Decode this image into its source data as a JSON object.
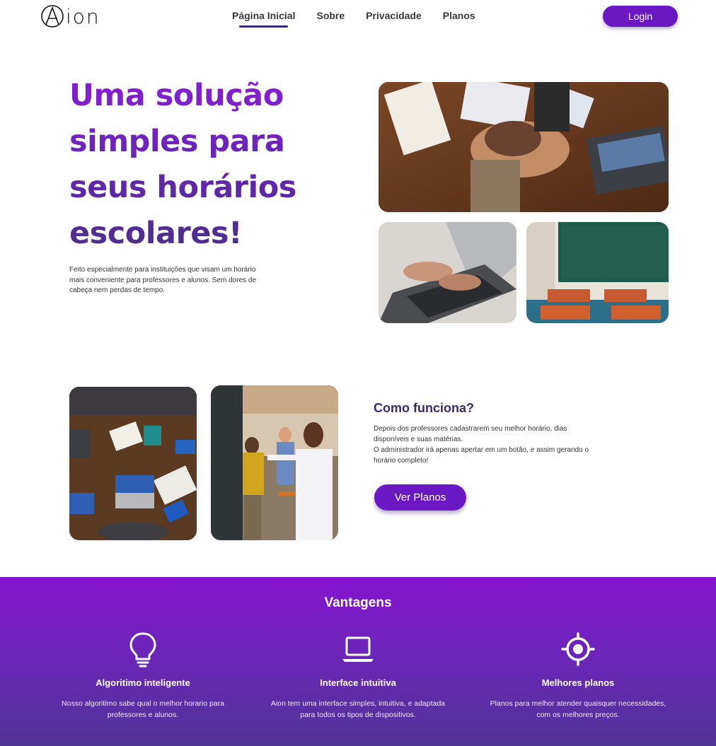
{
  "brand": {
    "name": "ion",
    "mark": "A"
  },
  "nav": {
    "items": [
      {
        "label": "Página Inicial",
        "active": true
      },
      {
        "label": "Sobre",
        "active": false
      },
      {
        "label": "Privacidade",
        "active": false
      },
      {
        "label": "Planos",
        "active": false
      }
    ],
    "login_label": "Login"
  },
  "hero": {
    "title_lines": [
      "Uma solução",
      "simples para",
      "seus horários",
      "escolares!"
    ],
    "description": "Feito especialmente para instituições que visam um horário mais conveniente para professores e alunos. Sem dores de cabeça nem perdas de tempo."
  },
  "how": {
    "title": "Como funciona?",
    "text_1": "Depois dos professores cadastrarem seu melhor horário, dias disponíveis e suas matérias.",
    "text_2": "O administrador irá apenas apertar em um botão, e assim gerando o horário completo!",
    "button_label": "Ver Planos"
  },
  "advantages": {
    "title": "Vantagens",
    "items": [
      {
        "icon": "lightbulb-icon",
        "title": "Algoritimo inteligente",
        "text": "Nosso algoritimo sabe qual o melhor horario para professores e alunos."
      },
      {
        "icon": "laptop-icon",
        "title": "Interface intuitiva",
        "text": "Aion tem uma interface simples, intuitiva, e adaptada para todos os tipos de dispositivos."
      },
      {
        "icon": "target-icon",
        "title": "Melhores planos",
        "text": "Planos para melhor atender quaisquer necessidades, com os melhores preços."
      }
    ]
  },
  "colors": {
    "accent": "#6a17c4",
    "nav_underline": "#3b2a7a",
    "section_top": "#8414cf",
    "section_bottom": "#4f3495"
  }
}
